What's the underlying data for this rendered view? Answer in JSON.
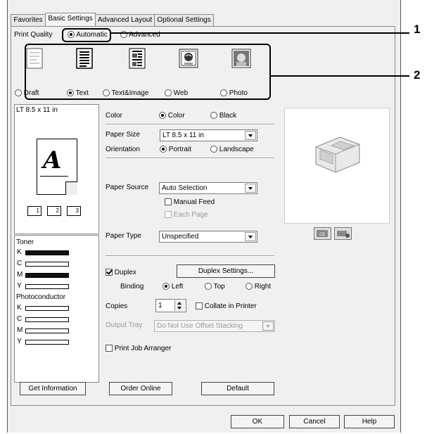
{
  "tabs": [
    "Favorites",
    "Basic Settings",
    "Advanced Layout",
    "Optional Settings"
  ],
  "print_quality": {
    "label": "Print Quality",
    "automatic": "Automatic",
    "advanced": "Advanced",
    "modes": [
      "Draft",
      "Text",
      "Text&Image",
      "Web",
      "Photo"
    ],
    "selected_mode": "Text"
  },
  "preview": {
    "paper_label": "LT 8.5 x 11 in",
    "glyph": "A",
    "page_numbers": [
      "1",
      "2",
      "3"
    ]
  },
  "color": {
    "label": "Color",
    "options": [
      "Color",
      "Black"
    ],
    "selected": "Color"
  },
  "paper_size": {
    "label": "Paper Size",
    "value": "LT 8.5 x 11 in"
  },
  "orientation": {
    "label": "Orientation",
    "options": [
      "Portrait",
      "Landscape"
    ],
    "selected": "Portrait"
  },
  "paper_source": {
    "label": "Paper Source",
    "value": "Auto Selection",
    "manual_feed": "Manual Feed",
    "each_page": "Each Page"
  },
  "paper_type": {
    "label": "Paper Type",
    "value": "Unspecified"
  },
  "toner": {
    "label": "Toner",
    "levels": [
      {
        "name": "K",
        "level": 1.0
      },
      {
        "name": "C",
        "level": 0.0
      },
      {
        "name": "M",
        "level": 1.0
      },
      {
        "name": "Y",
        "level": 0.0
      }
    ]
  },
  "photoconductor": {
    "label": "Photoconductor",
    "units": [
      "K",
      "C",
      "M",
      "Y"
    ]
  },
  "duplex": {
    "label": "Duplex",
    "checked": true,
    "settings_button": "Duplex Settings..."
  },
  "binding": {
    "label": "Binding",
    "options": [
      "Left",
      "Top",
      "Right"
    ],
    "selected": "Left"
  },
  "copies": {
    "label": "Copies",
    "value": "1",
    "collate": "Collate in Printer"
  },
  "output_tray": {
    "label": "Output Tray",
    "value": "Do Not Use Offset Stacking"
  },
  "print_job_arranger": "Print Job Arranger",
  "buttons": {
    "get_information": "Get Information",
    "order_online": "Order Online",
    "default": "Default",
    "ok": "OK",
    "cancel": "Cancel",
    "help": "Help"
  },
  "callouts": [
    "1",
    "2"
  ]
}
